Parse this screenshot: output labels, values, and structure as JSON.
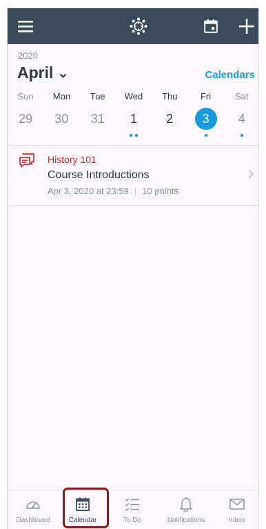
{
  "header": {
    "year": "2020",
    "month": "April",
    "calendars_link": "Calendars"
  },
  "week": {
    "days": [
      {
        "dow": "Sun",
        "date": "29",
        "state": "dim",
        "dots": 0
      },
      {
        "dow": "Mon",
        "date": "30",
        "state": "dim",
        "dots": 0
      },
      {
        "dow": "Tue",
        "date": "31",
        "state": "dim",
        "dots": 0
      },
      {
        "dow": "Wed",
        "date": "1",
        "state": "current",
        "dots": 2
      },
      {
        "dow": "Thu",
        "date": "2",
        "state": "current",
        "dots": 0
      },
      {
        "dow": "Fri",
        "date": "3",
        "state": "selected",
        "dots": 1
      },
      {
        "dow": "Sat",
        "date": "4",
        "state": "dim",
        "dots": 1
      }
    ]
  },
  "event": {
    "course": "History 101",
    "title": "Course Introductions",
    "due": "Apr 3, 2020 at 23:59",
    "separator": "|",
    "points": "10 points"
  },
  "tabbar": {
    "dashboard": "Dashboard",
    "calendar": "Calendar",
    "todo": "To Do",
    "notifications": "Notifications",
    "inbox": "Inbox"
  },
  "colors": {
    "topbar": "#394b58",
    "accent": "#1a9ad9",
    "course": "#d62a2a",
    "highlight": "#8b1a1a"
  }
}
